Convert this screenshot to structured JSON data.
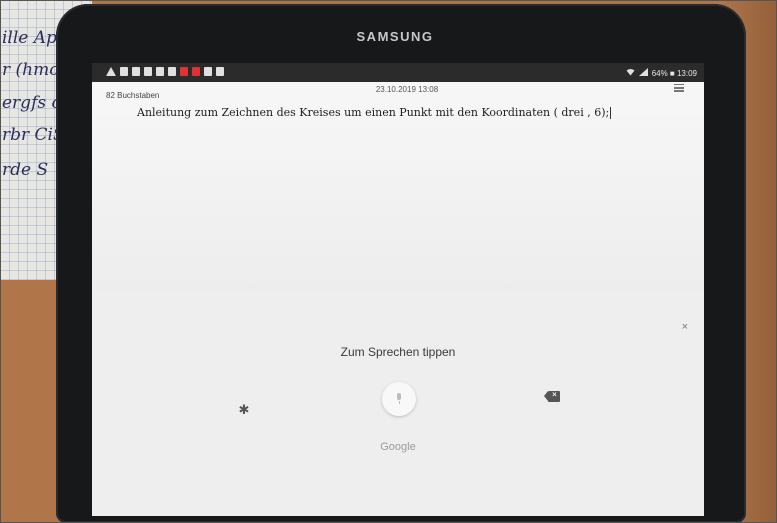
{
  "device": {
    "brand": "SAMSUNG"
  },
  "status_bar": {
    "right_text": "64% ■ 13:09"
  },
  "note": {
    "char_count": "82 Buchstaben",
    "datetime": "23.10.2019 13:08",
    "text": "Anleitung zum Zeichnen des Kreises um einen Punkt mit den Koordinaten ( drei , 6);"
  },
  "voice_input": {
    "prompt": "Zum Sprechen tippen",
    "provider": "Google",
    "close_symbol": "×"
  },
  "background": {
    "handwriting_lines": [
      "ille Apps",
      "r (hmo all",
      "ergfs o",
      "rbr CiS",
      "rde S"
    ]
  }
}
